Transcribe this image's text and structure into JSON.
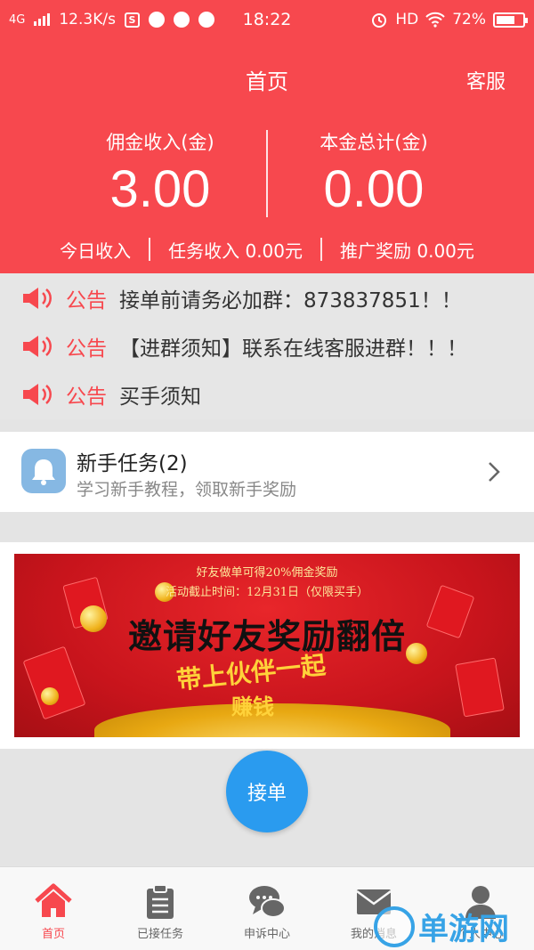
{
  "status_bar": {
    "network": "4G",
    "speed": "12.3K/s",
    "time": "18:22",
    "hd": "HD",
    "battery": "72%",
    "battery_level": 0.72
  },
  "header": {
    "title": "首页",
    "service": "客服",
    "commission_label": "佣金收入(金)",
    "commission_value": "3.00",
    "principal_label": "本金总计(金)",
    "principal_value": "0.00",
    "today_income": "今日收入",
    "task_income": "任务收入 0.00元",
    "promo_reward": "推广奖励 0.00元"
  },
  "notices": [
    {
      "tag": "公告",
      "text": "接单前请务必加群：873837851！！"
    },
    {
      "tag": "公告",
      "text": "【进群须知】联系在线客服进群！！！"
    },
    {
      "tag": "公告",
      "text": "买手须知"
    }
  ],
  "task": {
    "title": "新手任务(2)",
    "subtitle": "学习新手教程，领取新手奖励"
  },
  "banner": {
    "line1": "好友做单可得20%佣金奖励",
    "line2": "活动截止时间：12月31日（仅限买手）",
    "title": "邀请好友奖励翻倍",
    "sub1": "带上伙伴一起",
    "sub2": "赚钱"
  },
  "accept_button": "接单",
  "tabs": [
    {
      "label": "首页",
      "icon": "home-icon"
    },
    {
      "label": "已接任务",
      "icon": "clipboard-icon"
    },
    {
      "label": "申诉中心",
      "icon": "chat-bubbles-icon"
    },
    {
      "label": "我的消息",
      "icon": "envelope-icon"
    },
    {
      "label": "个人中心",
      "icon": "user-icon"
    }
  ],
  "watermark": "单游网",
  "colors": {
    "brand_red": "#f7484e",
    "accept_blue": "#2a9bef",
    "task_icon_blue": "#86b8e3"
  }
}
